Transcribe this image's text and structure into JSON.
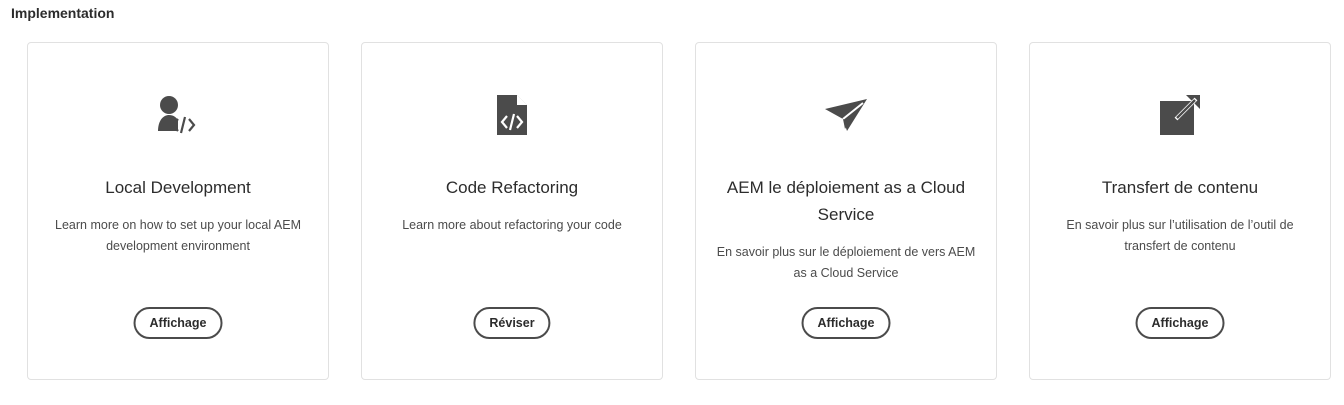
{
  "section": {
    "title": "Implementation"
  },
  "cards": [
    {
      "icon": "developer-code-icon",
      "title": "Local Development",
      "description": "Learn more on how to set up your local AEM development environment",
      "button": "Affichage"
    },
    {
      "icon": "code-file-icon",
      "title": "Code Refactoring",
      "description": "Learn more about refactoring your code",
      "button": "Réviser"
    },
    {
      "icon": "paper-plane-icon",
      "title": "AEM le déploiement as a Cloud Service",
      "description": "En savoir plus sur le déploiement de vers AEM as a Cloud Service",
      "button": "Affichage"
    },
    {
      "icon": "external-link-icon",
      "title": "Transfert de contenu",
      "description": "En savoir plus sur l’utilisation de l’outil de transfert de contenu",
      "button": "Affichage"
    }
  ],
  "colors": {
    "icon": "#4b4b4b",
    "text": "#2c2c2c",
    "border": "#e1e1e1"
  }
}
